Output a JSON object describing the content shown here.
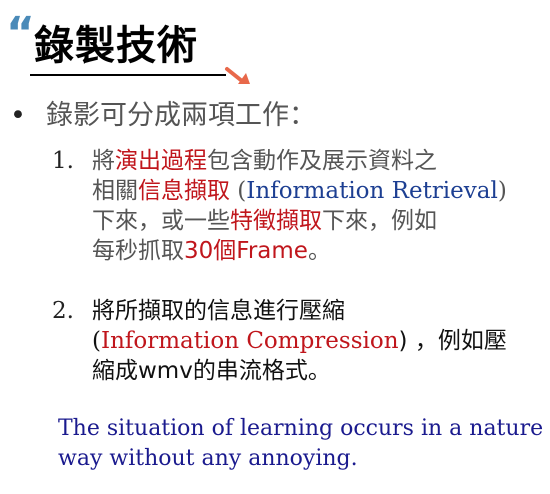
{
  "title": {
    "quote_glyph": "“",
    "text": "錄製技術"
  },
  "bullet": {
    "marker": "•",
    "text": "錄影可分成兩項工作："
  },
  "items": [
    {
      "number": "1.",
      "lines": [
        [
          {
            "t": "將",
            "c": "grey"
          },
          {
            "t": "演出過程",
            "c": "red"
          },
          {
            "t": "包含動作及展示資料之",
            "c": "grey"
          }
        ],
        [
          {
            "t": "相關",
            "c": "grey"
          },
          {
            "t": "信息擷取",
            "c": "red"
          },
          {
            "t": " (",
            "c": "grey"
          },
          {
            "t": "Information Retrieval",
            "c": "blue"
          },
          {
            "t": ")",
            "c": "grey"
          }
        ],
        [
          {
            "t": "下來，或一些",
            "c": "grey"
          },
          {
            "t": "特徵擷取",
            "c": "red"
          },
          {
            "t": "下來，例如",
            "c": "grey"
          }
        ],
        [
          {
            "t": "每秒抓取",
            "c": "grey"
          },
          {
            "t": "30個Frame",
            "c": "red"
          },
          {
            "t": "。",
            "c": "grey"
          }
        ]
      ]
    },
    {
      "number": "2.",
      "lines": [
        [
          {
            "t": "將所擷取的信息進行壓縮",
            "c": "black"
          }
        ],
        [
          {
            "t": "(",
            "c": "black"
          },
          {
            "t": "Information Compression",
            "c": "red"
          },
          {
            "t": ")  ，例如壓",
            "c": "black"
          }
        ],
        [
          {
            "t": "縮成wmv的串流格式。",
            "c": "black"
          }
        ]
      ]
    }
  ],
  "footer": {
    "line1": "The situation of learning occurs in a nature",
    "line2": "way without any annoying."
  },
  "colors": {
    "accent_blue": "#4a8ab8",
    "emphasis_red": "#c0161c",
    "term_blue": "#1d3f92",
    "footer_blue": "#1a1a8e",
    "arrow_orange": "#e8684a"
  }
}
